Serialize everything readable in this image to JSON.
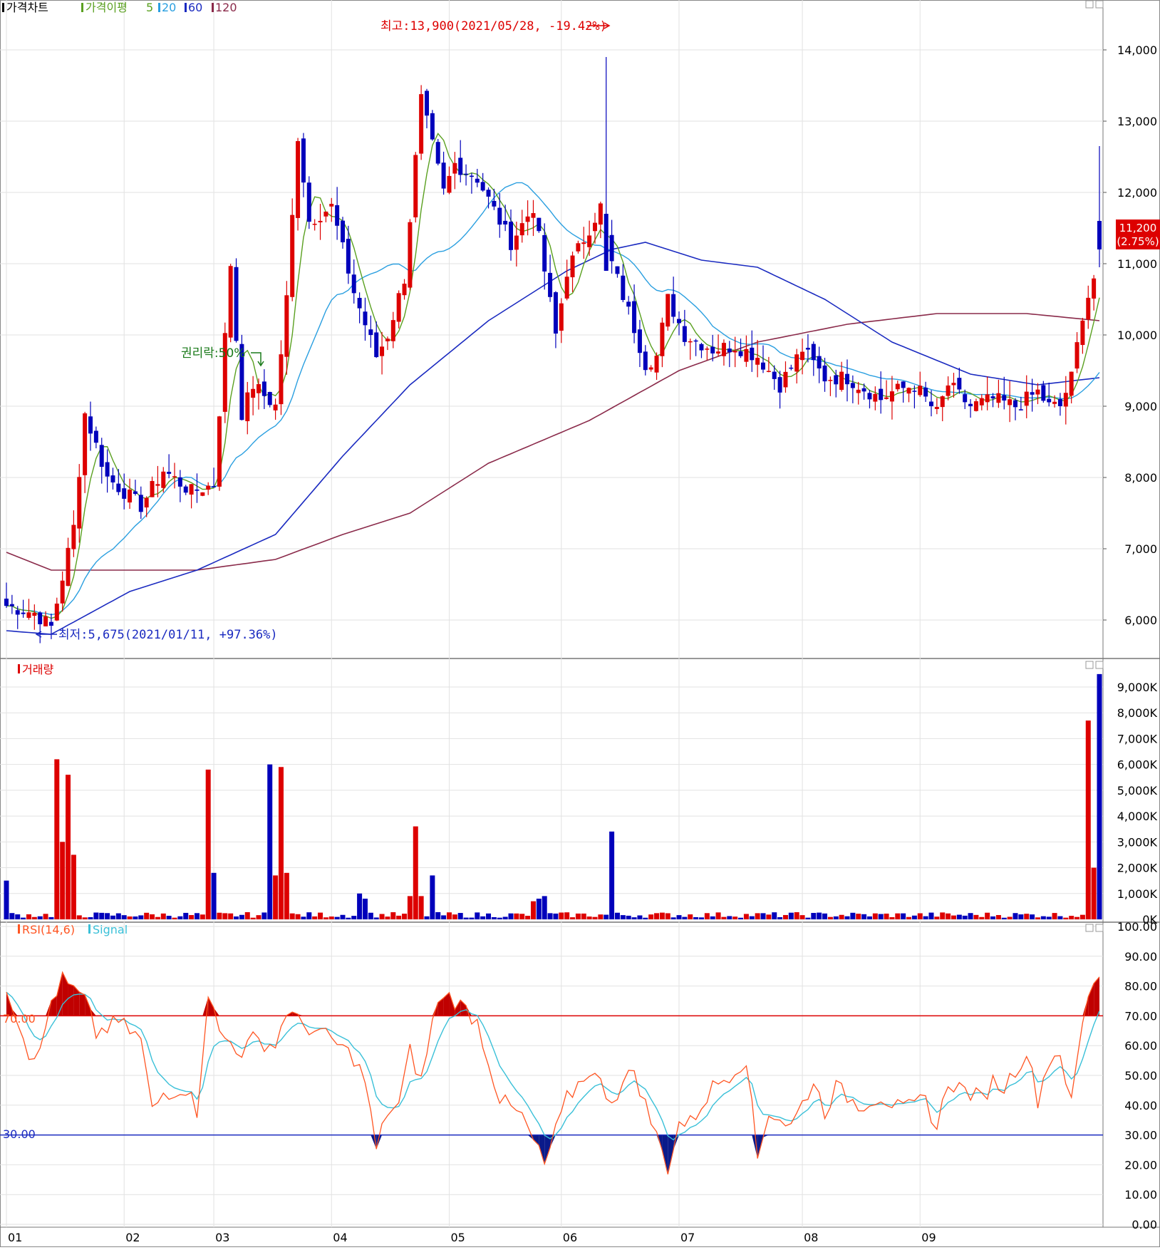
{
  "price_panel": {
    "legend": [
      "가격차트",
      "가격이평",
      "5",
      "20",
      "60",
      "120"
    ],
    "yticks": [
      "14,000",
      "13,000",
      "12,000",
      "11,000",
      "10,000",
      "9,000",
      "8,000",
      "7,000",
      "6,000"
    ],
    "current_price": "11,200",
    "current_change": "(2.75%)",
    "high_annotation": "최고:13,900(2021/05/28, -19.42%)",
    "low_annotation": "최저:5,675(2021/01/11, +97.36%)",
    "rights_annotation": "권리락:50%"
  },
  "volume_panel": {
    "legend": [
      "거래량"
    ],
    "yticks": [
      "9,000K",
      "8,000K",
      "7,000K",
      "6,000K",
      "5,000K",
      "4,000K",
      "3,000K",
      "2,000K",
      "1,000K",
      "0K"
    ]
  },
  "rsi_panel": {
    "legend": [
      "RSI(14,6)",
      "Signal"
    ],
    "yticks": [
      "100.00",
      "90.00",
      "80.00",
      "70.00",
      "60.00",
      "50.00",
      "40.00",
      "30.00",
      "20.00",
      "10.00",
      "0.00"
    ],
    "upper_label": "70.00",
    "lower_label": "30.00"
  },
  "xaxis": {
    "ticks": [
      "01",
      "02",
      "03",
      "04",
      "05",
      "06",
      "07",
      "08",
      "09"
    ]
  },
  "colors": {
    "up": "#dd0000",
    "down": "#0000bb",
    "ma5": "#5aa020",
    "ma20": "#2a9fe0",
    "ma60": "#1a2ac0",
    "ma120": "#8a2a4a",
    "rsi": "#ff5522",
    "signal": "#3ac0d8"
  },
  "chart_data": [
    {
      "type": "candlestick",
      "title": "가격차트",
      "ylim": [
        5500,
        14400
      ],
      "x_ticks": [
        "01",
        "02",
        "03",
        "04",
        "05",
        "06",
        "07",
        "08",
        "09"
      ],
      "series_names": [
        "5",
        "20",
        "60",
        "120"
      ],
      "close_anchors": [
        [
          0,
          6200
        ],
        [
          5,
          6100
        ],
        [
          8,
          5900
        ],
        [
          12,
          7300
        ],
        [
          14,
          8900
        ],
        [
          18,
          8000
        ],
        [
          24,
          7600
        ],
        [
          28,
          8100
        ],
        [
          33,
          7800
        ],
        [
          37,
          7900
        ],
        [
          40,
          11000
        ],
        [
          42,
          8900
        ],
        [
          44,
          9300
        ],
        [
          48,
          9000
        ],
        [
          50,
          10500
        ],
        [
          52,
          12800
        ],
        [
          54,
          11600
        ],
        [
          58,
          11800
        ],
        [
          62,
          10600
        ],
        [
          66,
          9700
        ],
        [
          68,
          10000
        ],
        [
          71,
          10800
        ],
        [
          74,
          13300
        ],
        [
          78,
          12000
        ],
        [
          80,
          12400
        ],
        [
          84,
          12200
        ],
        [
          88,
          11600
        ],
        [
          90,
          11300
        ],
        [
          94,
          11800
        ],
        [
          98,
          10000
        ],
        [
          100,
          10900
        ],
        [
          104,
          11500
        ],
        [
          106,
          11800
        ],
        [
          108,
          11000
        ],
        [
          112,
          10100
        ],
        [
          114,
          9600
        ],
        [
          116,
          9700
        ],
        [
          118,
          10500
        ],
        [
          121,
          10000
        ],
        [
          126,
          9800
        ],
        [
          130,
          9850
        ],
        [
          134,
          9700
        ],
        [
          138,
          9300
        ],
        [
          142,
          9800
        ],
        [
          146,
          9400
        ],
        [
          150,
          9400
        ],
        [
          156,
          9100
        ],
        [
          158,
          9200
        ],
        [
          162,
          9300
        ],
        [
          166,
          8900
        ],
        [
          168,
          9300
        ],
        [
          172,
          9000
        ],
        [
          176,
          9100
        ],
        [
          180,
          9000
        ],
        [
          184,
          9200
        ],
        [
          186,
          9000
        ],
        [
          188,
          9000
        ],
        [
          190,
          9400
        ],
        [
          192,
          10300
        ],
        [
          194,
          10800
        ],
        [
          195,
          11200
        ]
      ],
      "high_point": {
        "label": "최고",
        "value": 13900,
        "date": "2021/05/28",
        "change": "-19.42%"
      },
      "low_point": {
        "label": "최저",
        "value": 5675,
        "date": "2021/01/11",
        "change": "+97.36%"
      },
      "ma120_anchors": [
        [
          0,
          6950
        ],
        [
          8,
          6700
        ],
        [
          20,
          6700
        ],
        [
          34,
          6700
        ],
        [
          48,
          6850
        ],
        [
          60,
          7200
        ],
        [
          72,
          7500
        ],
        [
          86,
          8200
        ],
        [
          104,
          8800
        ],
        [
          120,
          9500
        ],
        [
          134,
          9900
        ],
        [
          150,
          10150
        ],
        [
          166,
          10300
        ],
        [
          182,
          10300
        ],
        [
          195,
          10200
        ]
      ],
      "ma60_anchors": [
        [
          0,
          5850
        ],
        [
          8,
          5800
        ],
        [
          22,
          6400
        ],
        [
          34,
          6700
        ],
        [
          48,
          7200
        ],
        [
          60,
          8300
        ],
        [
          72,
          9300
        ],
        [
          86,
          10200
        ],
        [
          100,
          10900
        ],
        [
          108,
          11200
        ],
        [
          114,
          11300
        ],
        [
          124,
          11050
        ],
        [
          134,
          10950
        ],
        [
          146,
          10500
        ],
        [
          158,
          9900
        ],
        [
          172,
          9450
        ],
        [
          184,
          9300
        ],
        [
          195,
          9400
        ]
      ],
      "annotations": [
        "최고:13,900(2021/05/28, -19.42%)",
        "최저:5,675(2021/01/11, +97.36%)",
        "권리락:50%"
      ],
      "last_value": "11,200",
      "last_change": "(2.75%)"
    },
    {
      "type": "bar",
      "title": "거래량",
      "ylim": [
        0,
        9800
      ],
      "unit": "K",
      "x_ticks": [
        "01",
        "02",
        "03",
        "04",
        "05",
        "06",
        "07",
        "08",
        "09"
      ],
      "spikes": [
        [
          0,
          1500
        ],
        [
          9,
          6200
        ],
        [
          10,
          3000
        ],
        [
          11,
          5600
        ],
        [
          12,
          2500
        ],
        [
          36,
          5800
        ],
        [
          37,
          1800
        ],
        [
          47,
          6000
        ],
        [
          48,
          1700
        ],
        [
          49,
          5900
        ],
        [
          50,
          1800
        ],
        [
          63,
          1000
        ],
        [
          64,
          800
        ],
        [
          72,
          900
        ],
        [
          73,
          3600
        ],
        [
          74,
          900
        ],
        [
          76,
          1700
        ],
        [
          94,
          700
        ],
        [
          95,
          800
        ],
        [
          96,
          900
        ],
        [
          108,
          3400
        ],
        [
          193,
          7700
        ],
        [
          194,
          2000
        ],
        [
          195,
          9500
        ]
      ]
    },
    {
      "type": "line",
      "title": "RSI(14,6)",
      "ylim": [
        0,
        100
      ],
      "series_names": [
        "RSI(14,6)",
        "Signal"
      ],
      "thresholds": [
        70,
        30
      ],
      "rsi_anchors": [
        [
          0,
          80
        ],
        [
          4,
          58
        ],
        [
          6,
          57
        ],
        [
          8,
          75
        ],
        [
          10,
          82
        ],
        [
          14,
          75
        ],
        [
          16,
          64
        ],
        [
          20,
          68
        ],
        [
          24,
          62
        ],
        [
          26,
          38
        ],
        [
          28,
          44
        ],
        [
          32,
          46
        ],
        [
          34,
          38
        ],
        [
          36,
          78
        ],
        [
          38,
          64
        ],
        [
          42,
          58
        ],
        [
          44,
          62
        ],
        [
          48,
          60
        ],
        [
          50,
          72
        ],
        [
          52,
          68
        ],
        [
          58,
          62
        ],
        [
          62,
          56
        ],
        [
          64,
          48
        ],
        [
          66,
          25
        ],
        [
          68,
          38
        ],
        [
          70,
          40
        ],
        [
          72,
          58
        ],
        [
          74,
          48
        ],
        [
          76,
          68
        ],
        [
          78,
          78
        ],
        [
          82,
          72
        ],
        [
          84,
          68
        ],
        [
          88,
          42
        ],
        [
          92,
          36
        ],
        [
          96,
          20
        ],
        [
          100,
          42
        ],
        [
          104,
          52
        ],
        [
          108,
          42
        ],
        [
          112,
          52
        ],
        [
          114,
          40
        ],
        [
          118,
          19
        ],
        [
          120,
          34
        ],
        [
          122,
          34
        ],
        [
          126,
          46
        ],
        [
          130,
          52
        ],
        [
          132,
          56
        ],
        [
          134,
          22
        ],
        [
          136,
          38
        ],
        [
          140,
          33
        ],
        [
          144,
          48
        ],
        [
          146,
          38
        ],
        [
          148,
          46
        ],
        [
          152,
          40
        ],
        [
          156,
          43
        ],
        [
          160,
          38
        ],
        [
          164,
          42
        ],
        [
          166,
          32
        ],
        [
          168,
          48
        ],
        [
          170,
          46
        ],
        [
          174,
          42
        ],
        [
          176,
          48
        ],
        [
          178,
          46
        ],
        [
          182,
          58
        ],
        [
          184,
          42
        ],
        [
          186,
          55
        ],
        [
          188,
          58
        ],
        [
          190,
          40
        ],
        [
          192,
          68
        ],
        [
          194,
          82
        ],
        [
          195,
          84
        ]
      ]
    }
  ]
}
